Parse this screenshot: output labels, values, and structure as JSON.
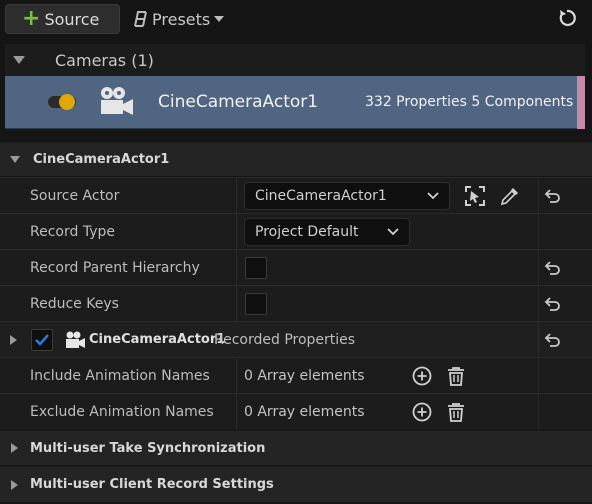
{
  "toolbar": {
    "source_label": "Source",
    "presets_label": "Presets",
    "reset_icon": "reset-icon"
  },
  "cameras": {
    "header": "Cameras (1)",
    "item": {
      "name": "CineCameraActor1",
      "summary": "332 Properties 5 Components"
    }
  },
  "details": {
    "section_title": "CineCameraActor1",
    "rows": {
      "source_actor": {
        "label": "Source Actor",
        "value": "CineCameraActor1"
      },
      "record_type": {
        "label": "Record Type",
        "value": "Project Default"
      },
      "record_parent_hierarchy": {
        "label": "Record Parent Hierarchy"
      },
      "reduce_keys": {
        "label": "Reduce Keys"
      },
      "recorded": {
        "actor": "CineCameraActor1",
        "suffix": "Recorded Properties"
      },
      "include_anim": {
        "label": "Include Animation Names",
        "value": "0 Array elements"
      },
      "exclude_anim": {
        "label": "Exclude Animation Names",
        "value": "0 Array elements"
      }
    },
    "sections": {
      "multi_user_take": "Multi-user Take Synchronization",
      "multi_user_client": "Multi-user Client Record Settings"
    }
  },
  "colors": {
    "accent_green": "#7ac142",
    "selection_blue": "#4f6582",
    "checkbox_blue": "#1e5fbf",
    "toggle_yellow": "#e0a800"
  }
}
